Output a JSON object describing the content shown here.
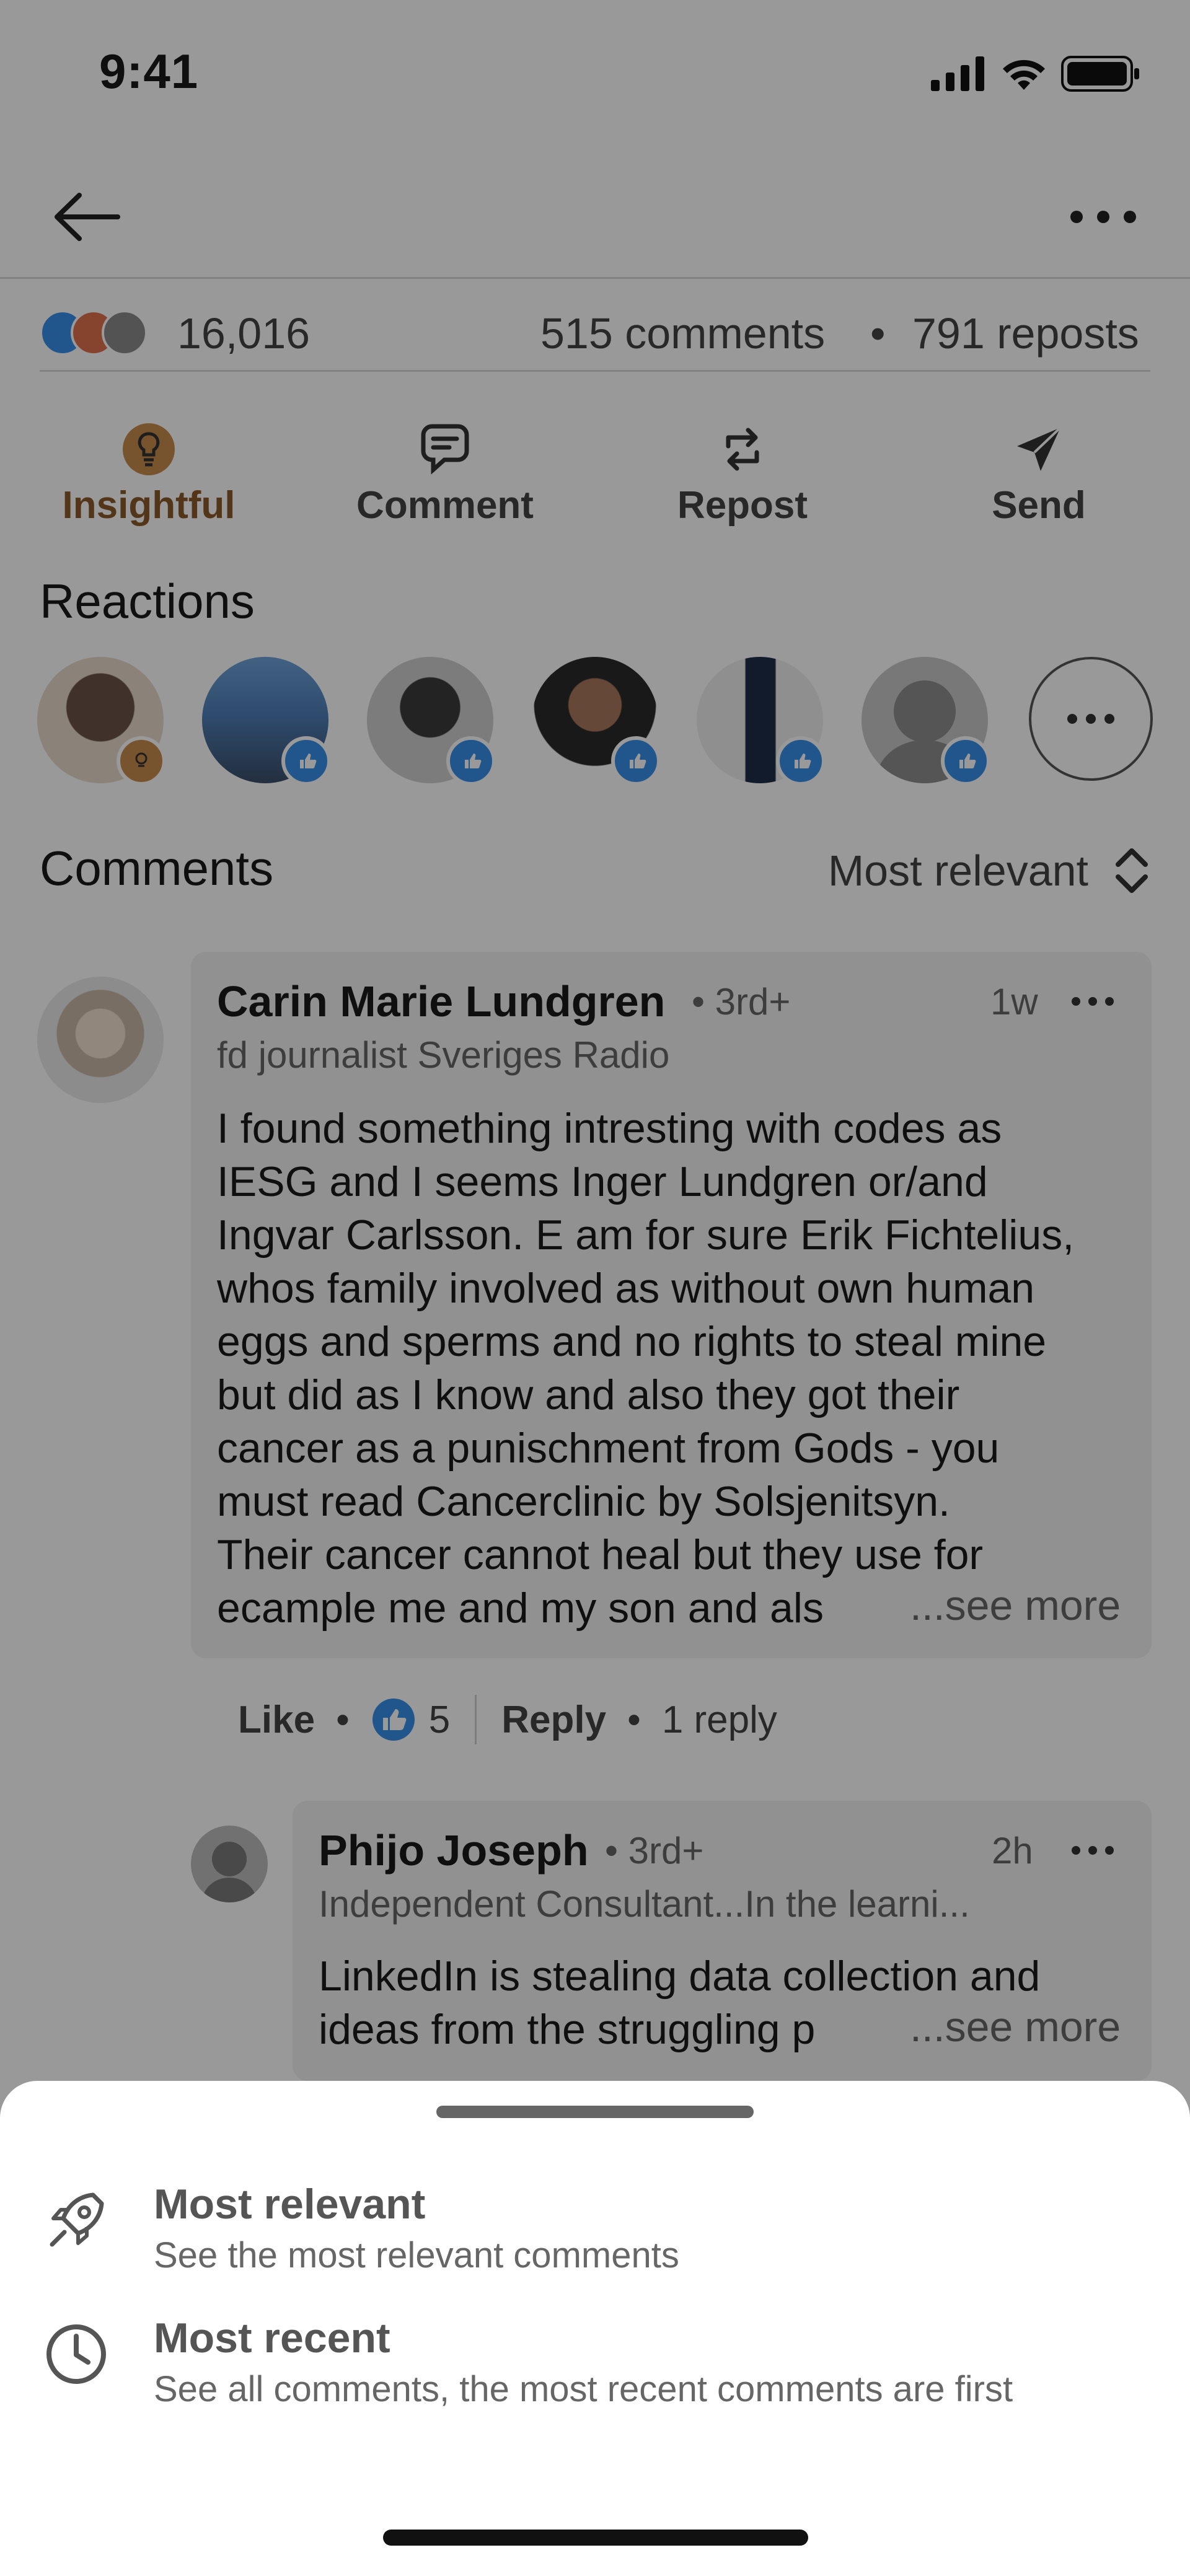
{
  "status_bar": {
    "time": "9:41"
  },
  "post_stats": {
    "reactions_count": "16,016",
    "comments_count": "515 comments",
    "separator": "•",
    "reposts_count": "791 reposts"
  },
  "actions": [
    {
      "label": "Insightful",
      "icon": "lightbulb-icon",
      "active": true
    },
    {
      "label": "Comment",
      "icon": "comment-icon",
      "active": false
    },
    {
      "label": "Repost",
      "icon": "repost-icon",
      "active": false
    },
    {
      "label": "Send",
      "icon": "send-icon",
      "active": false
    }
  ],
  "reactions_section": {
    "title": "Reactions"
  },
  "comments_section": {
    "title": "Comments",
    "sort_label": "Most relevant"
  },
  "comment": {
    "author": "Carin Marie Lundgren",
    "degree": "• 3rd+",
    "time": "1w",
    "headline": "fd journalist Sveriges Radio",
    "body_lines": [
      "I found something intresting with codes as",
      "IESG and I seems Inger Lundgren or/and",
      "Ingvar Carlsson. E am for sure Erik Fichtelius,",
      "whos family involved as without own human",
      "eggs and sperms and no rights to steal mine",
      "but did as I know and also they got their",
      "cancer as a punischment from Gods - you",
      "must read Cancerclinic by Solsjenitsyn.",
      "Their cancer cannot heal but they use for",
      "ecample me and my son and als"
    ],
    "see_more": "...see more",
    "like_label": "Like",
    "dot": "•",
    "like_count": "5",
    "reply_label": "Reply",
    "reply_count": "1 reply"
  },
  "reply": {
    "author": "Phijo Joseph",
    "degree": "• 3rd+",
    "time": "2h",
    "headline": "Independent Consultant...In the learni...",
    "body_lines": [
      "LinkedIn is stealing data collection and",
      "ideas from the struggling p"
    ],
    "see_more": "...see more"
  },
  "sort_sheet": {
    "options": [
      {
        "title": "Most relevant",
        "description": "See the most relevant comments",
        "icon": "rocket-icon"
      },
      {
        "title": "Most recent",
        "description": "See all comments, the most recent comments are first",
        "icon": "clock-icon"
      }
    ]
  },
  "colors": {
    "insightful": "#8a5a2b",
    "like_blue": "#378fe9",
    "text_primary": "#191919",
    "text_secondary": "#666666"
  }
}
